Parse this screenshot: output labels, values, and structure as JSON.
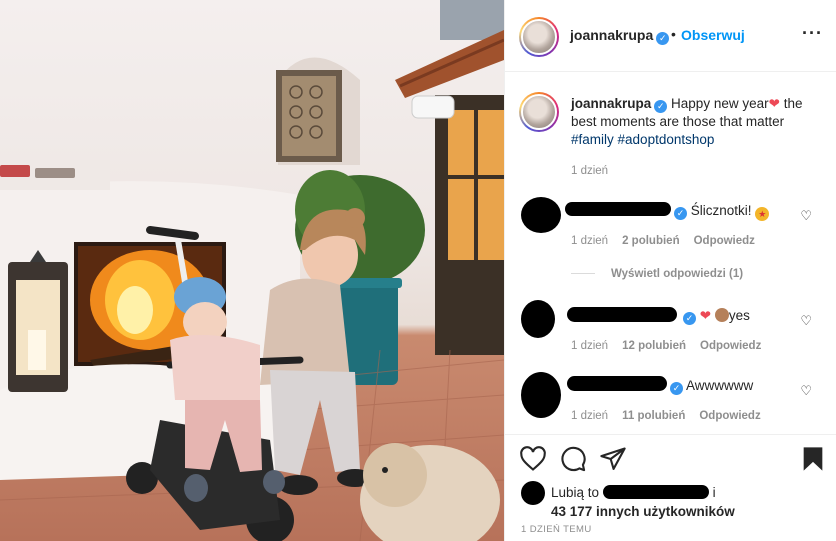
{
  "post": {
    "author": "joannakrupa",
    "follow_label": "Obserwuj",
    "separator": "•",
    "more_icon": "more-options-icon",
    "verified_icon": "verified-badge-icon"
  },
  "caption": {
    "username": "joannakrupa",
    "text_line1": "Happy new year",
    "heart_emoji": "❤",
    "text_line2": "the best moments are those that matter",
    "hashtag1": "#family",
    "hashtag2": "#adoptdontshop",
    "time": "1 dzień"
  },
  "comments": [
    {
      "text": "Ślicznotki!",
      "emoji": "🤩",
      "time": "1 dzień",
      "likes": "2 polubień",
      "reply": "Odpowiedz",
      "view_replies": "Wyświetl odpowiedzi (1)"
    },
    {
      "text_emoji1": "❤",
      "text_emoji2": "👏",
      "text": "yes",
      "time": "1 dzień",
      "likes": "12 polubień",
      "reply": "Odpowiedz"
    },
    {
      "text": "Awwwwww",
      "time": "1 dzień",
      "likes": "11 polubień",
      "reply": "Odpowiedz"
    }
  ],
  "actions": {
    "like_icon": "heart-icon",
    "comment_icon": "comment-icon",
    "share_icon": "share-icon",
    "save_icon": "bookmark-icon"
  },
  "likes": {
    "prefix": "Lubią to",
    "suffix_i": "i",
    "count_text": "43 177 innych użytkowników"
  },
  "posted_ago": "1 DZIEŃ TEMU",
  "colors": {
    "accent": "#0095f6",
    "verified": "#3897f0",
    "muted": "#8e8e8e",
    "heart": "#ed4956",
    "hashtag": "#00376b"
  }
}
